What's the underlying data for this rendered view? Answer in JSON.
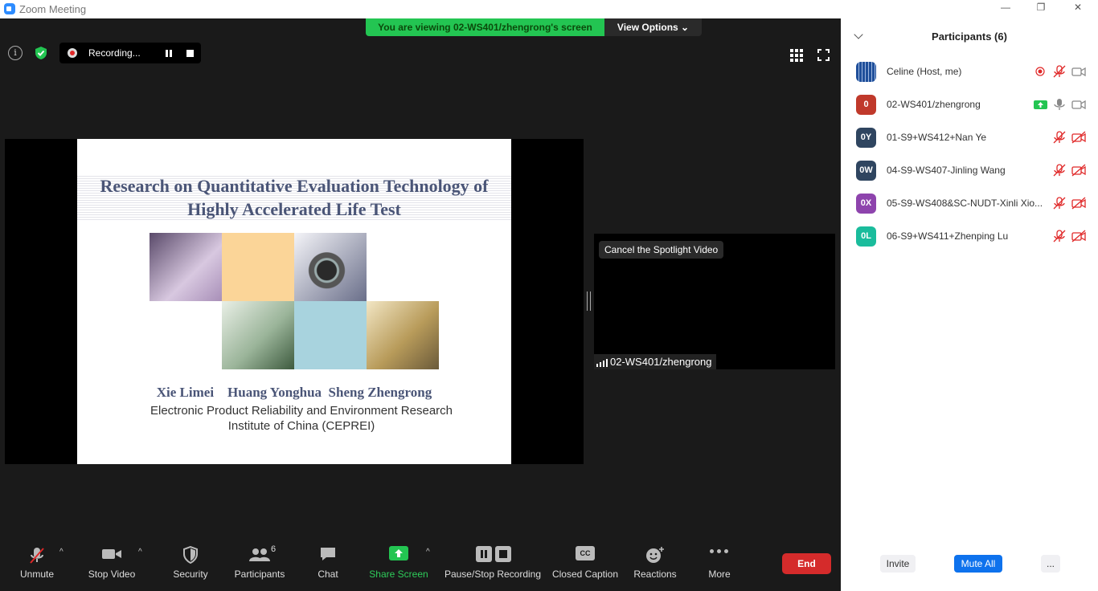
{
  "window": {
    "title": "Zoom Meeting",
    "controls": [
      "—",
      "❐",
      "✕"
    ]
  },
  "banner": {
    "message": "You are viewing 02-WS401/zhengrong's screen",
    "view_options": "View Options ⌄"
  },
  "recording": {
    "label": "Recording..."
  },
  "slide": {
    "title_line1": "Research on Quantitative Evaluation Technology of",
    "title_line2": "Highly Accelerated Life Test",
    "authors": "Xie Limei    Huang Yonghua  Sheng Zhengrong",
    "institution_line1": "Electronic Product Reliability and Environment Research",
    "institution_line2": "Institute of China (CEPREI)"
  },
  "spotlight": {
    "cancel_label": "Cancel the Spotlight Video",
    "name": "02-WS401/zhengrong"
  },
  "toolbar": {
    "unmute": "Unmute",
    "stop_video": "Stop Video",
    "security": "Security",
    "participants": "Participants",
    "participants_count": "6",
    "chat": "Chat",
    "share_screen": "Share Screen",
    "pause_stop_recording": "Pause/Stop Recording",
    "closed_caption": "Closed Caption",
    "cc_badge": "CC",
    "reactions": "Reactions",
    "more": "More",
    "end": "End"
  },
  "panel": {
    "title": "Participants (6)",
    "participants": [
      {
        "initials": "",
        "name": "Celine (Host, me)",
        "color": "#1f4f9a"
      },
      {
        "initials": "0",
        "name": "02-WS401/zhengrong",
        "color": "#c0392b"
      },
      {
        "initials": "0Y",
        "name": "01-S9+WS412+Nan Ye",
        "color": "#2f4560"
      },
      {
        "initials": "0W",
        "name": "04-S9-WS407-Jinling Wang",
        "color": "#2f4560"
      },
      {
        "initials": "0X",
        "name": "05-S9-WS408&SC-NUDT-Xinli Xio...",
        "color": "#8e44ad"
      },
      {
        "initials": "0L",
        "name": "06-S9+WS411+Zhenping Lu",
        "color": "#1abc9c"
      }
    ],
    "invite": "Invite",
    "mute_all": "Mute All",
    "more": "..."
  },
  "colors": {
    "accent": "#0e72ed",
    "end": "#d52b2b",
    "banner": "#23c552",
    "share": "#2ecc5a"
  }
}
